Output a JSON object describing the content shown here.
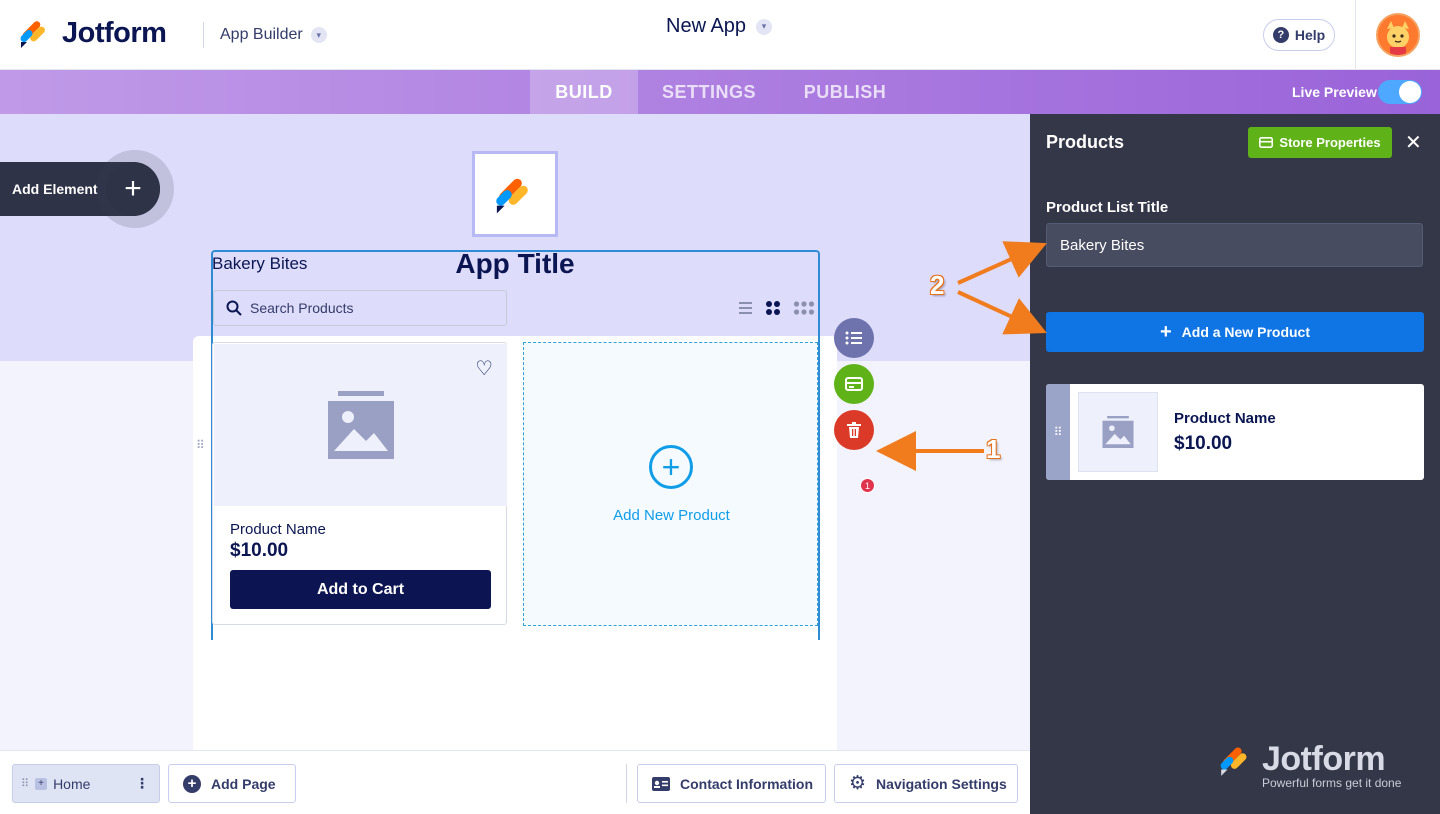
{
  "header": {
    "logo_text": "Jotform",
    "builder_label": "App Builder",
    "app_name": "New App",
    "help_label": "Help"
  },
  "nav": {
    "tabs": [
      {
        "label": "BUILD",
        "active": true
      },
      {
        "label": "SETTINGS",
        "active": false
      },
      {
        "label": "PUBLISH",
        "active": false
      }
    ],
    "live_preview_label": "Live Preview",
    "live_preview_on": true
  },
  "canvas": {
    "add_element_label": "Add Element",
    "app_title": "App Title",
    "product_list": {
      "title": "Bakery Bites",
      "search_placeholder": "Search Products",
      "product": {
        "name": "Product Name",
        "price": "$10.00",
        "cta": "Add to Cart"
      },
      "add_new_label": "Add New Product"
    },
    "store_badge_count": "1"
  },
  "bottom": {
    "page_label": "Home",
    "add_page_label": "Add Page",
    "contact_label": "Contact Information",
    "nav_settings_label": "Navigation Settings"
  },
  "panel": {
    "title": "Products",
    "store_properties_label": "Store Properties",
    "product_list_title_label": "Product List Title",
    "product_list_title_value": "Bakery Bites",
    "add_product_label": "Add a New Product",
    "product": {
      "name": "Product Name",
      "price": "$10.00"
    },
    "watermark_brand": "Jotform",
    "watermark_tagline": "Powerful forms get it done"
  },
  "annotations": {
    "one": "1",
    "two": "2"
  },
  "colors": {
    "brand_navy": "#0a1551",
    "accent_purple": "#9a63d9",
    "panel_bg": "#343748",
    "primary_blue": "#0f74e4",
    "success_green": "#5fb319",
    "danger_red": "#db3a28",
    "annotation_orange": "#e8711c"
  }
}
